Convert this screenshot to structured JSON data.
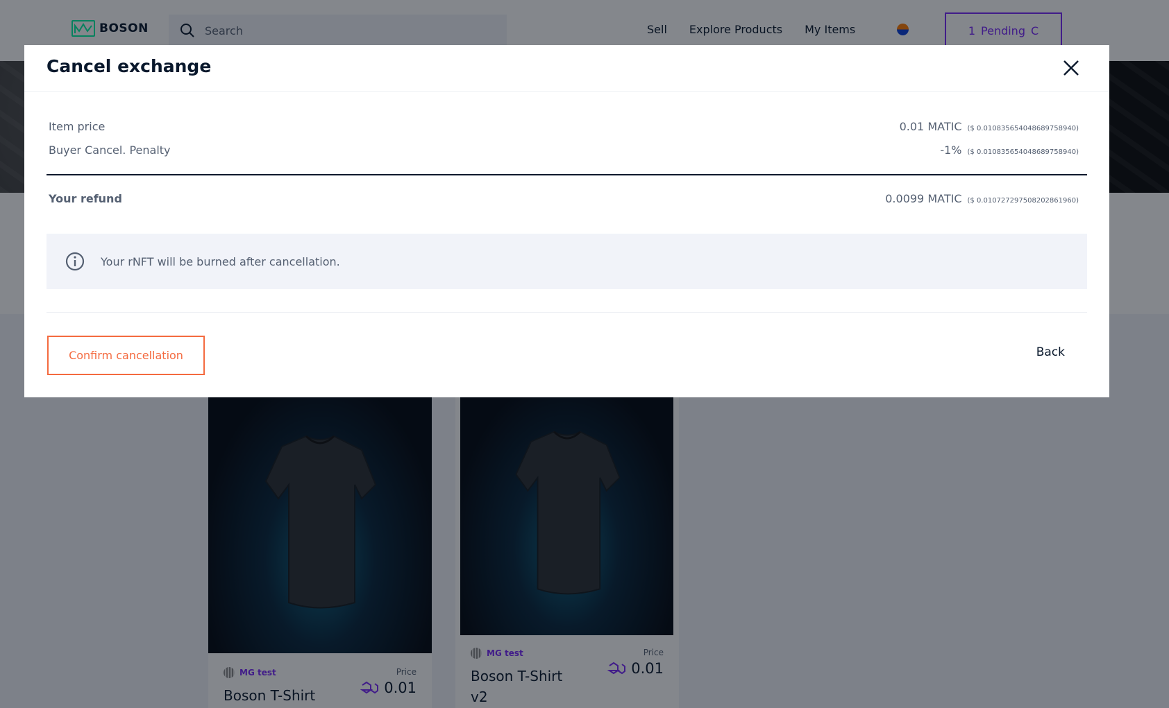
{
  "navbar": {
    "logo_text": "BOSON",
    "search_placeholder": "Search",
    "links": [
      "Sell",
      "Explore Products",
      "My Items"
    ],
    "pending_count": "1",
    "pending_label": "Pending",
    "pending_icon": "C"
  },
  "products": [
    {
      "seller": "MG test",
      "title": "Boson T-Shirt",
      "price_label": "Price",
      "price": "0.01"
    },
    {
      "seller": "MG test",
      "title": "Boson T-Shirt v2",
      "price_label": "Price",
      "price": "0.01"
    }
  ],
  "modal": {
    "title": "Cancel exchange",
    "item_price_label": "Item price",
    "item_price_value": "0.01 MATIC",
    "item_price_usd": "($ 0.010835654048689758940)",
    "penalty_label": "Buyer Cancel. Penalty",
    "penalty_value": "-1%",
    "penalty_usd": "($ 0.010835654048689758940)",
    "refund_label": "Your refund",
    "refund_value": "0.0099 MATIC",
    "refund_usd": "($ 0.010727297508202861960)",
    "info_text": "Your rNFT will be burned after cancellation.",
    "confirm_label": "Confirm cancellation",
    "back_label": "Back"
  },
  "colors": {
    "accent": "#7829f9",
    "danger": "#f46a3f",
    "brand_green": "#02f3a2",
    "text": "#09182c",
    "muted": "#556072"
  },
  "icons": [
    "boson-logo-icon",
    "search-icon",
    "close-icon",
    "info-icon",
    "polygon-icon",
    "avatar-icon",
    "loading-icon"
  ]
}
